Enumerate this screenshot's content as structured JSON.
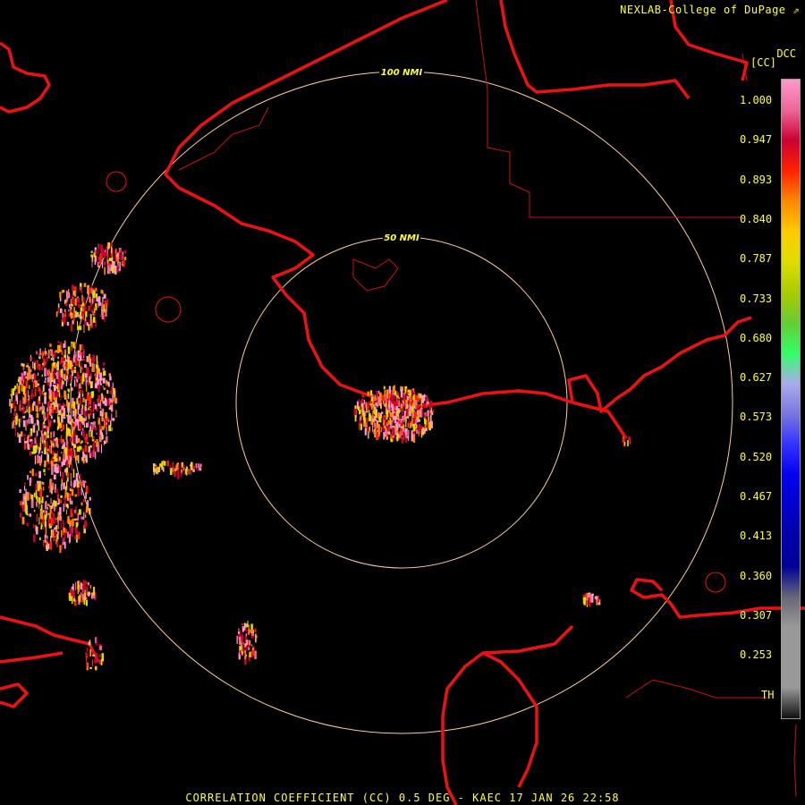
{
  "credit": "NEXLAB-College of DuPage",
  "colorbar": {
    "name": "DCC",
    "unit": "[CC]",
    "ticks": [
      "1.000",
      "0.947",
      "0.893",
      "0.840",
      "0.787",
      "0.733",
      "0.680",
      "0.627",
      "0.573",
      "0.520",
      "0.467",
      "0.413",
      "0.360",
      "0.307",
      "0.253",
      "TH"
    ],
    "colors": [
      "#ff99cc",
      "#ee6699",
      "#cc0033",
      "#ff2200",
      "#ff8800",
      "#ffcc00",
      "#dddd00",
      "#aacc00",
      "#66cc33",
      "#33ff66",
      "#aaaaee",
      "#7777dd",
      "#3333ff",
      "#0000ee",
      "#0000cc",
      "#0000aa",
      "#000099",
      "#666677",
      "#999999",
      "#999999",
      "#999999",
      "#111111"
    ]
  },
  "rings": [
    {
      "label": "100 NMI"
    },
    {
      "label": "50 NMI"
    }
  ],
  "footer": "CORRELATION COEFFICIENT (CC) 0.5 DEG - KAEC 17 JAN 26 22:58"
}
